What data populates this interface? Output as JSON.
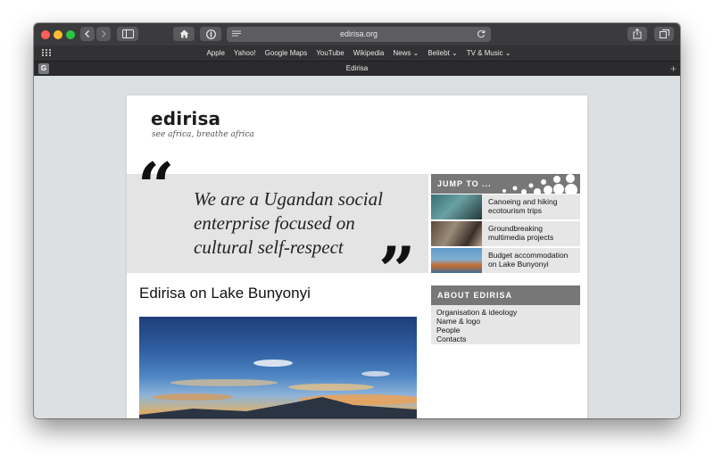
{
  "browser": {
    "url": "edirisa.org",
    "tab_title": "Edirisa",
    "tab_favicon_letter": "G",
    "favorites": [
      "Apple",
      "Yahoo!",
      "Google Maps",
      "YouTube",
      "Wikipedia",
      "News ⌄",
      "Beliebt ⌄",
      "TV & Music ⌄"
    ]
  },
  "site": {
    "logo": "edirisa",
    "tagline": "see africa, breathe africa",
    "quote_lines": [
      "We are a Ugandan social",
      "enterprise focused on",
      "cultural self-respect"
    ],
    "heading": "Edirisa on Lake Bunyonyi"
  },
  "sidebar": {
    "jump_label": "JUMP TO ...",
    "jump_items": [
      {
        "label": "Canoeing and hiking ecotourism trips"
      },
      {
        "label": "Groundbreaking multimedia projects"
      },
      {
        "label": "Budget accommodation on Lake Bunyonyi"
      }
    ],
    "about_label": "ABOUT EDIRISA",
    "about_links": [
      "Organisation & ideology",
      "Name & logo",
      "People",
      "Contacts"
    ]
  },
  "colors": {
    "sidebar_header": "#777777",
    "sidebar_box": "#e6e6e6",
    "quote_box": "#e4e4e4",
    "toolbar": "#3b3b3d"
  }
}
